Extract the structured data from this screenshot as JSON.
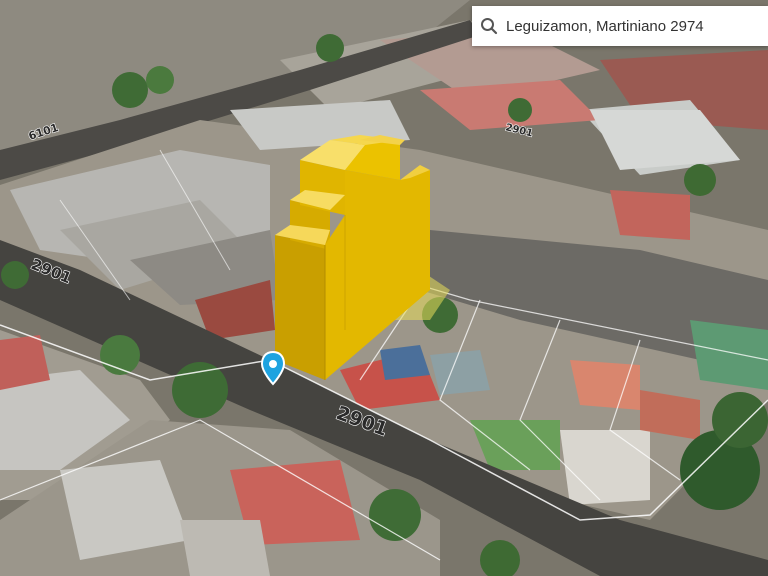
{
  "search": {
    "value": "Leguizamon, Martiniano 2974",
    "icon": "search-icon"
  },
  "map": {
    "street_number_left": "2901",
    "street_number_front": "2901",
    "street_number_top": "6101",
    "street_number_top2": "2901",
    "building_color": "#f2c400",
    "marker_color": "#1ea3e0",
    "marker_icon": "location-pin-icon"
  }
}
